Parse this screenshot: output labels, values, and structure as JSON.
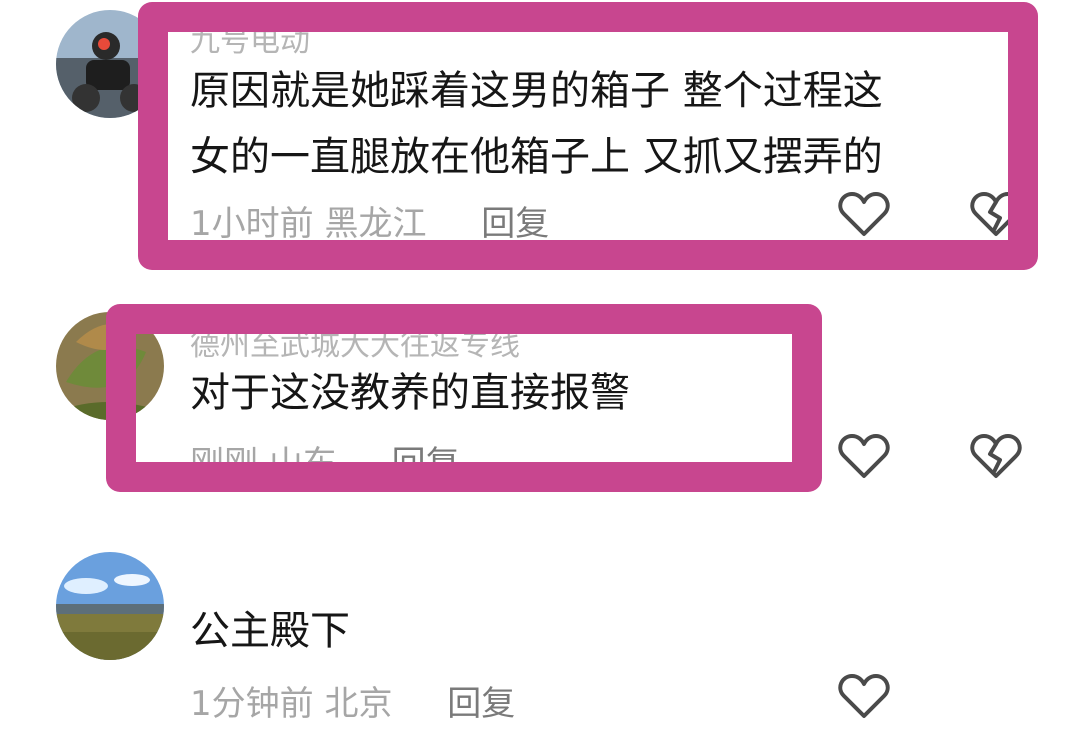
{
  "comments": [
    {
      "username": "九号电动",
      "lines": [
        "原因就是她踩着这男的箱子 整个过程这",
        "女的一直腿放在他箱子上 又抓又摆弄的"
      ],
      "time": "1小时前",
      "location": "黑龙江",
      "reply": "回复",
      "highlighted": true
    },
    {
      "username": "德州至武城大大往返专线",
      "lines": [
        "对于这没教养的直接报警"
      ],
      "time": "刚刚",
      "location": "山东",
      "reply": "回复",
      "highlighted": true
    },
    {
      "username": "",
      "lines": [
        "公主殿下"
      ],
      "time": "1分钟前",
      "location": "北京",
      "reply": "回复",
      "highlighted": false
    }
  ],
  "icons": {
    "like": "heart-outline-icon",
    "dislike": "broken-heart-icon"
  },
  "colors": {
    "highlight_border": "#c8468f",
    "meta_text": "#a6a6a6",
    "body_text": "#161616"
  }
}
